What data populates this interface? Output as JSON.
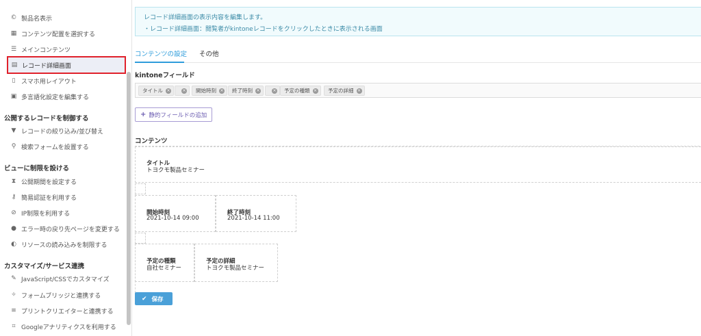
{
  "sidebar": {
    "items_top": [
      {
        "icon": "copyright-icon",
        "glyph": "©",
        "label": "製品名表示"
      },
      {
        "icon": "grid-icon",
        "glyph": "▦",
        "label": "コンテンツ配置を選択する"
      },
      {
        "icon": "list-icon",
        "glyph": "☰",
        "label": "メインコンテンツ"
      },
      {
        "icon": "table-icon",
        "glyph": "▤",
        "label": "レコード詳細画面"
      },
      {
        "icon": "mobile-icon",
        "glyph": "▯",
        "label": "スマホ用レイアウト"
      },
      {
        "icon": "language-icon",
        "glyph": "▣",
        "label": "多言語化設定を編集する"
      }
    ],
    "section_publish": {
      "title": "公開するレコードを制御する",
      "items": [
        {
          "icon": "filter-icon",
          "glyph": "▼",
          "label": "レコードの絞り込み/並び替え"
        },
        {
          "icon": "search-icon",
          "glyph": "⚲",
          "label": "検索フォームを設置する"
        }
      ]
    },
    "section_restrict": {
      "title": "ビューに制限を設ける",
      "items": [
        {
          "icon": "hourglass-icon",
          "glyph": "⧗",
          "label": "公開期間を設定する"
        },
        {
          "icon": "key-icon",
          "glyph": "⚷",
          "label": "簡易認証を利用する"
        },
        {
          "icon": "ban-icon",
          "glyph": "⊘",
          "label": "IP制限を利用する"
        },
        {
          "icon": "alert-icon",
          "glyph": "●",
          "label": "エラー時の戻り先ページを変更する"
        },
        {
          "icon": "shield-icon",
          "glyph": "◐",
          "label": "リソースの読み込みを制限する"
        }
      ]
    },
    "section_custom": {
      "title": "カスタマイズ/サービス連携",
      "items": [
        {
          "icon": "wrench-icon",
          "glyph": "✎",
          "label": "JavaScript/CSSでカスタマイズ"
        },
        {
          "icon": "sparkle-icon",
          "glyph": "✧",
          "label": "フォームブリッジと連携する"
        },
        {
          "icon": "print-icon",
          "glyph": "≡",
          "label": "プリントクリエイターと連携する"
        },
        {
          "icon": "chart-icon",
          "glyph": "⌗",
          "label": "Googleアナリティクスを利用する"
        }
      ]
    }
  },
  "info": {
    "line1": "レコード詳細画面の表示内容を編集します。",
    "line2": "・レコード詳細画面：閲覧者がkintoneレコードをクリックしたときに表示される画面"
  },
  "tabs": [
    {
      "label": "コンテンツの設定"
    },
    {
      "label": "その他"
    }
  ],
  "kintone_fields": {
    "label": "kintoneフィールド",
    "chips": [
      "タイトル",
      "",
      "開始時刻",
      "終了時刻",
      "",
      "予定の種類",
      "予定の詳細"
    ],
    "remove_glyph": "×"
  },
  "add_static_field": {
    "plus": "+",
    "label": "静的フィールドの追加"
  },
  "contents": {
    "label": "コンテンツ",
    "title_card": {
      "name": "タイトル",
      "value": "トヨクモ製品セミナー"
    },
    "start_card": {
      "name": "開始時刻",
      "value": "2021-10-14 09:00"
    },
    "end_card": {
      "name": "終了時刻",
      "value": "2021-10-14 11:00"
    },
    "type_card": {
      "name": "予定の種類",
      "value": "自社セミナー"
    },
    "detail_card": {
      "name": "予定の詳細",
      "value": "トヨクモ製品セミナー"
    }
  },
  "save": {
    "check": "✔",
    "label": "保存"
  },
  "colors": {
    "accent": "#2d9cdb",
    "selected_border": "#e0202a",
    "save_button": "#4aa0d8"
  }
}
